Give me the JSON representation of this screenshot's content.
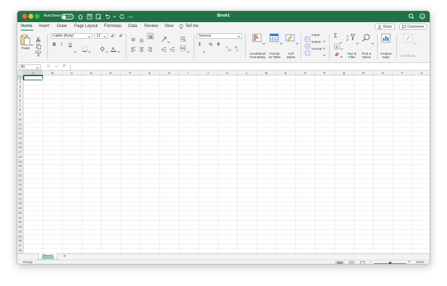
{
  "titlebar": {
    "autosave_label": "AutoSave",
    "autosave_state": "OFF",
    "document_title": "Book1",
    "bg_color": "#217346"
  },
  "tabs": [
    {
      "label": "Home",
      "active": true
    },
    {
      "label": "Insert"
    },
    {
      "label": "Draw"
    },
    {
      "label": "Page Layout"
    },
    {
      "label": "Formulas"
    },
    {
      "label": "Data"
    },
    {
      "label": "Review"
    },
    {
      "label": "View"
    },
    {
      "label": "Tell me"
    }
  ],
  "share_label": "Share",
  "comments_label": "Comments",
  "ribbon": {
    "paste_label": "Paste",
    "font_name": "Calibri (Body)",
    "font_size": "12",
    "number_format": "General",
    "bold": "B",
    "italic": "I",
    "underline": "U",
    "currency": "$",
    "percent": "%",
    "comma": "9",
    "conditional_formatting": [
      "Conditional",
      "Formatting"
    ],
    "format_as_table": [
      "Format",
      "as Table"
    ],
    "cell_styles": [
      "Cell",
      "Styles"
    ],
    "insert_label": "Insert",
    "delete_label": "Delete",
    "format_label": "Format",
    "sort_filter": [
      "Sort &",
      "Filter"
    ],
    "find_select": [
      "Find &",
      "Select"
    ],
    "analyze_data": [
      "Analyze",
      "Data"
    ],
    "sensitivity_label": "Sensitivity",
    "sum_icon": "Σ"
  },
  "formula_bar": {
    "name_box": "A1",
    "fx": "fx",
    "value": ""
  },
  "columns": [
    "A",
    "B",
    "C",
    "D",
    "E",
    "F",
    "G",
    "H",
    "I",
    "J",
    "K",
    "L",
    "M",
    "N",
    "O",
    "P",
    "Q",
    "R",
    "S",
    "T",
    "U"
  ],
  "rows": [
    "1",
    "2",
    "3",
    "4",
    "5",
    "6",
    "7",
    "8",
    "9",
    "10",
    "11",
    "12",
    "13",
    "14",
    "15",
    "16",
    "17",
    "18",
    "19",
    "20",
    "21",
    "22",
    "23",
    "24",
    "25",
    "26",
    "27",
    "28",
    "29",
    "30",
    "31",
    "32",
    "33",
    "34",
    "35",
    "36",
    "37",
    "38"
  ],
  "selected_cell": "A1",
  "sheets": [
    {
      "name": "Sheet1",
      "active": true
    }
  ],
  "status": {
    "ready": "Ready",
    "zoom": "100%",
    "zoom_level": 1.0
  }
}
